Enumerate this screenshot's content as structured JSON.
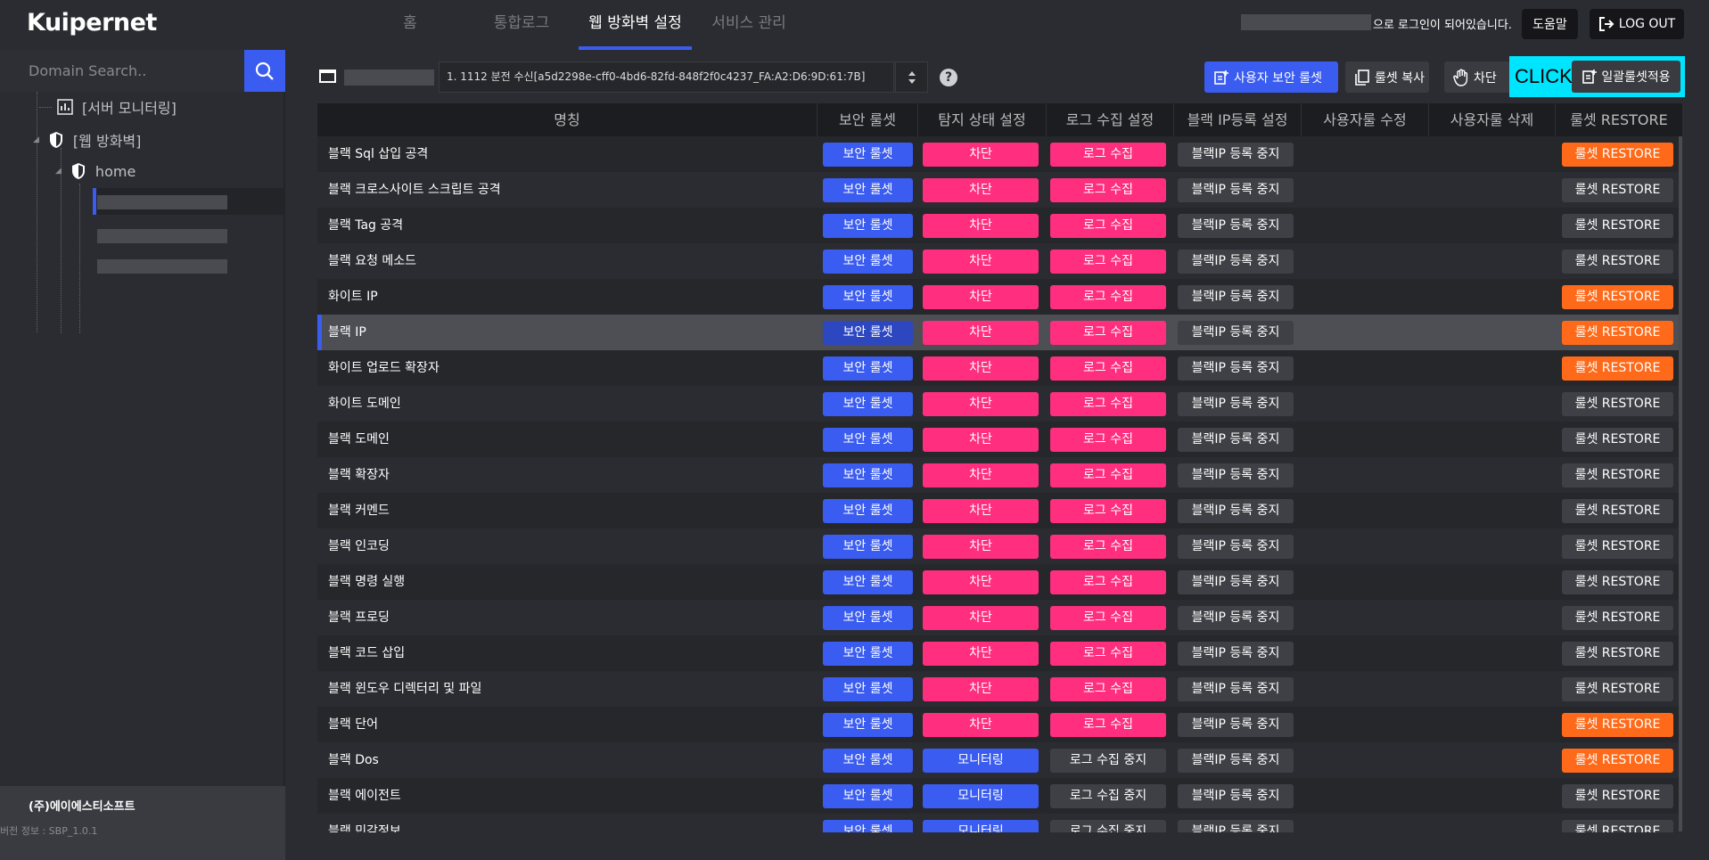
{
  "header": {
    "logo": "Kuipernet",
    "nav": [
      "홈",
      "통합로그",
      "웹 방화벽 설정",
      "서비스 관리"
    ],
    "active_nav": "웹 방화벽 설정",
    "login_text": "으로 로그인이 되어있습니다.",
    "help_label": "도움말",
    "logout_label": "LOG OUT"
  },
  "sidebar": {
    "search_placeholder": "Domain Search..",
    "tree": [
      "[서버 모니터링]",
      "[웹 방화벽]",
      "home"
    ],
    "company": "(주)에이에스티소프트",
    "version": "버전 정보 : SBP_1.0.1"
  },
  "toolbar": {
    "policy_value": "1. 1112 분전 수신[a5d2298e-cff0-4bd6-82fd-848f2f0c4237_FA:A2:D6:9D:61:7B]",
    "help_glyph": "?",
    "user_ruleset_label": "사용자 보안 룰셋",
    "copy_label": "룰셋 복사",
    "block_label": "차단",
    "click_label": "CLICK",
    "bulk_apply_label": "일괄룰셋적용"
  },
  "table": {
    "headers": [
      "명칭",
      "보안 룰셋",
      "탐지 상태 설정",
      "로그 수집 설정",
      "블랙 IP등록 설정",
      "사용자룰 수정",
      "사용자룰 삭제",
      "룰셋 RESTORE"
    ],
    "rows": [
      {
        "name": "블랙 Sql 삽입 공격",
        "ruleset": "보안 룰셋",
        "detect": "차단",
        "log": "로그 수집",
        "ip": "블랙IP 등록 중지",
        "restore": "룰셋 RESTORE",
        "detect_style": "pink",
        "log_style": "pink",
        "restore_style": "orange"
      },
      {
        "name": "블랙 크로스사이트 스크립트 공격",
        "ruleset": "보안 룰셋",
        "detect": "차단",
        "log": "로그 수집",
        "ip": "블랙IP 등록 중지",
        "restore": "룰셋 RESTORE",
        "detect_style": "pink",
        "log_style": "pink",
        "restore_style": "gray"
      },
      {
        "name": "블랙 Tag 공격",
        "ruleset": "보안 룰셋",
        "detect": "차단",
        "log": "로그 수집",
        "ip": "블랙IP 등록 중지",
        "restore": "룰셋 RESTORE",
        "detect_style": "pink",
        "log_style": "pink",
        "restore_style": "gray"
      },
      {
        "name": "블랙 요청 메소드",
        "ruleset": "보안 룰셋",
        "detect": "차단",
        "log": "로그 수집",
        "ip": "블랙IP 등록 중지",
        "restore": "룰셋 RESTORE",
        "detect_style": "pink",
        "log_style": "pink",
        "restore_style": "gray"
      },
      {
        "name": "화이트 IP",
        "ruleset": "보안 룰셋",
        "detect": "차단",
        "log": "로그 수집",
        "ip": "블랙IP 등록 중지",
        "restore": "룰셋 RESTORE",
        "detect_style": "pink",
        "log_style": "pink",
        "restore_style": "orange"
      },
      {
        "name": "블랙 IP",
        "ruleset": "보안 룰셋",
        "detect": "차단",
        "log": "로그 수집",
        "ip": "블랙IP 등록 중지",
        "restore": "룰셋 RESTORE",
        "detect_style": "pink",
        "log_style": "pink",
        "restore_style": "orange",
        "selected": true
      },
      {
        "name": "화이트 업로드 확장자",
        "ruleset": "보안 룰셋",
        "detect": "차단",
        "log": "로그 수집",
        "ip": "블랙IP 등록 중지",
        "restore": "룰셋 RESTORE",
        "detect_style": "pink",
        "log_style": "pink",
        "restore_style": "orange"
      },
      {
        "name": "화이트 도메인",
        "ruleset": "보안 룰셋",
        "detect": "차단",
        "log": "로그 수집",
        "ip": "블랙IP 등록 중지",
        "restore": "룰셋 RESTORE",
        "detect_style": "pink",
        "log_style": "pink",
        "restore_style": "gray"
      },
      {
        "name": "블랙 도메인",
        "ruleset": "보안 룰셋",
        "detect": "차단",
        "log": "로그 수집",
        "ip": "블랙IP 등록 중지",
        "restore": "룰셋 RESTORE",
        "detect_style": "pink",
        "log_style": "pink",
        "restore_style": "gray"
      },
      {
        "name": "블랙 확장자",
        "ruleset": "보안 룰셋",
        "detect": "차단",
        "log": "로그 수집",
        "ip": "블랙IP 등록 중지",
        "restore": "룰셋 RESTORE",
        "detect_style": "pink",
        "log_style": "pink",
        "restore_style": "gray"
      },
      {
        "name": "블랙 커멘드",
        "ruleset": "보안 룰셋",
        "detect": "차단",
        "log": "로그 수집",
        "ip": "블랙IP 등록 중지",
        "restore": "룰셋 RESTORE",
        "detect_style": "pink",
        "log_style": "pink",
        "restore_style": "gray"
      },
      {
        "name": "블랙 인코딩",
        "ruleset": "보안 룰셋",
        "detect": "차단",
        "log": "로그 수집",
        "ip": "블랙IP 등록 중지",
        "restore": "룰셋 RESTORE",
        "detect_style": "pink",
        "log_style": "pink",
        "restore_style": "gray"
      },
      {
        "name": "블랙 명령 실행",
        "ruleset": "보안 룰셋",
        "detect": "차단",
        "log": "로그 수집",
        "ip": "블랙IP 등록 중지",
        "restore": "룰셋 RESTORE",
        "detect_style": "pink",
        "log_style": "pink",
        "restore_style": "gray"
      },
      {
        "name": "블랙 프로딩",
        "ruleset": "보안 룰셋",
        "detect": "차단",
        "log": "로그 수집",
        "ip": "블랙IP 등록 중지",
        "restore": "룰셋 RESTORE",
        "detect_style": "pink",
        "log_style": "pink",
        "restore_style": "gray"
      },
      {
        "name": "블랙 코드 삽입",
        "ruleset": "보안 룰셋",
        "detect": "차단",
        "log": "로그 수집",
        "ip": "블랙IP 등록 중지",
        "restore": "룰셋 RESTORE",
        "detect_style": "pink",
        "log_style": "pink",
        "restore_style": "gray"
      },
      {
        "name": "블랙 윈도우 디렉터리 및 파일",
        "ruleset": "보안 룰셋",
        "detect": "차단",
        "log": "로그 수집",
        "ip": "블랙IP 등록 중지",
        "restore": "룰셋 RESTORE",
        "detect_style": "pink",
        "log_style": "pink",
        "restore_style": "gray"
      },
      {
        "name": "블랙 단어",
        "ruleset": "보안 룰셋",
        "detect": "차단",
        "log": "로그 수집",
        "ip": "블랙IP 등록 중지",
        "restore": "룰셋 RESTORE",
        "detect_style": "pink",
        "log_style": "pink",
        "restore_style": "orange"
      },
      {
        "name": "블랙 Dos",
        "ruleset": "보안 룰셋",
        "detect": "모니터링",
        "log": "로그 수집 중지",
        "ip": "블랙IP 등록 중지",
        "restore": "룰셋 RESTORE",
        "detect_style": "blue",
        "log_style": "gray",
        "restore_style": "orange"
      },
      {
        "name": "블랙 에이전트",
        "ruleset": "보안 룰셋",
        "detect": "모니터링",
        "log": "로그 수집 중지",
        "ip": "블랙IP 등록 중지",
        "restore": "룰셋 RESTORE",
        "detect_style": "blue",
        "log_style": "gray",
        "restore_style": "gray"
      },
      {
        "name": "블랙 민감정보",
        "ruleset": "보안 룰셋",
        "detect": "모니터링",
        "log": "로그 수집 중지",
        "ip": "블랙IP 등록 중지",
        "restore": "룰셋 RESTORE",
        "detect_style": "blue",
        "log_style": "gray",
        "restore_style": "gray"
      }
    ]
  },
  "colors": {
    "accent": "#3a5cf0",
    "pink": "#ff2e7e",
    "orange": "#ff6a1a",
    "highlight": "#00e5ff"
  }
}
